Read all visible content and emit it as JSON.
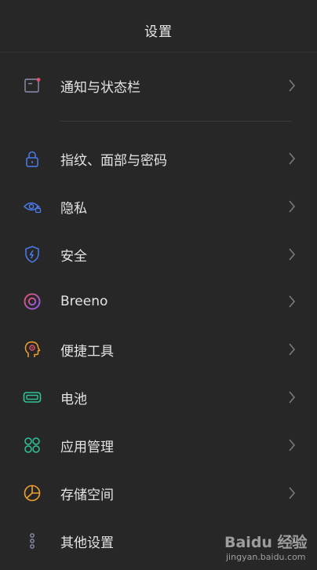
{
  "header": {
    "title": "设置"
  },
  "items": [
    {
      "label": "通知与状态栏",
      "icon": "notification-statusbar-icon",
      "color": "#e0506e"
    },
    {
      "label": "指纹、面部与密码",
      "icon": "lock-icon",
      "color": "#4a7cf0"
    },
    {
      "label": "隐私",
      "icon": "privacy-eye-icon",
      "color": "#4a7cf0"
    },
    {
      "label": "安全",
      "icon": "security-shield-icon",
      "color": "#4a7cf0"
    },
    {
      "label": "Breeno",
      "icon": "breeno-icon",
      "color": "#e0506e"
    },
    {
      "label": "便捷工具",
      "icon": "convenient-tools-icon",
      "color": "#f0a030"
    },
    {
      "label": "电池",
      "icon": "battery-icon",
      "color": "#2ec49a"
    },
    {
      "label": "应用管理",
      "icon": "app-management-icon",
      "color": "#2ec49a"
    },
    {
      "label": "存储空间",
      "icon": "storage-pie-icon",
      "color": "#f0a030"
    },
    {
      "label": "其他设置",
      "icon": "other-settings-icon",
      "color": "#8a8fb0"
    }
  ],
  "watermark": {
    "logo": "Baidu 经验",
    "url": "jingyan.baidu.com"
  }
}
